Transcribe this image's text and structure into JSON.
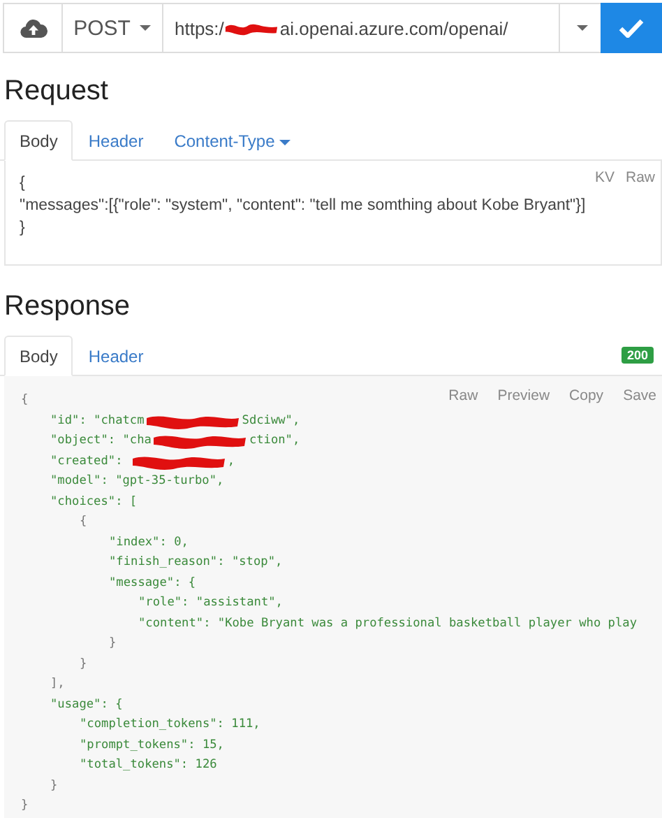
{
  "toolbar": {
    "method": "POST",
    "url_segments": [
      "https:/",
      "ai.openai.azure.com/openai/"
    ]
  },
  "request": {
    "title": "Request",
    "tabs": [
      {
        "label": "Body",
        "selected": true,
        "kind": "tab"
      },
      {
        "label": "Header",
        "selected": false,
        "kind": "tab"
      },
      {
        "label": "Content-Type",
        "selected": false,
        "kind": "dropdown"
      }
    ],
    "modes": [
      "KV",
      "Raw"
    ],
    "body_lines": [
      "{",
      "\"messages\":[{\"role\": \"system\", \"content\": \"tell me somthing about Kobe Bryant\"}]",
      "}"
    ]
  },
  "response": {
    "title": "Response",
    "tabs": [
      {
        "label": "Body",
        "selected": true
      },
      {
        "label": "Header",
        "selected": false
      }
    ],
    "status": "200",
    "actions": [
      "Raw",
      "Preview",
      "Copy",
      "Save"
    ],
    "body": [
      {
        "text": "{",
        "children": [
          {
            "segments": [
              "\"id\": \"chatcm",
              "Sdciww\","
            ]
          },
          {
            "segments": [
              "\"object\": \"cha",
              "ction\","
            ]
          },
          {
            "segments": [
              "\"created\": ",
              ","
            ]
          },
          {
            "text": "\"model\": \"gpt-35-turbo\","
          },
          {
            "text": "\"choices\": [",
            "children": [
              {
                "text": "{",
                "children": [
                  {
                    "text": "\"index\": 0,"
                  },
                  {
                    "text": "\"finish_reason\": \"stop\","
                  },
                  {
                    "text": "\"message\": {",
                    "children": [
                      {
                        "text": "\"role\": \"assistant\","
                      },
                      {
                        "text": "\"content\": \"Kobe Bryant was a professional basketball player who play"
                      }
                    ]
                  },
                  {
                    "text": "}"
                  }
                ]
              },
              {
                "text": "}"
              }
            ]
          },
          {
            "text": "],"
          },
          {
            "text": "\"usage\": {",
            "children": [
              {
                "text": "\"completion_tokens\": 111,"
              },
              {
                "text": "\"prompt_tokens\": 15,"
              },
              {
                "text": "\"total_tokens\": 126"
              }
            ]
          },
          {
            "text": "}"
          }
        ]
      },
      {
        "text": "}"
      }
    ]
  }
}
